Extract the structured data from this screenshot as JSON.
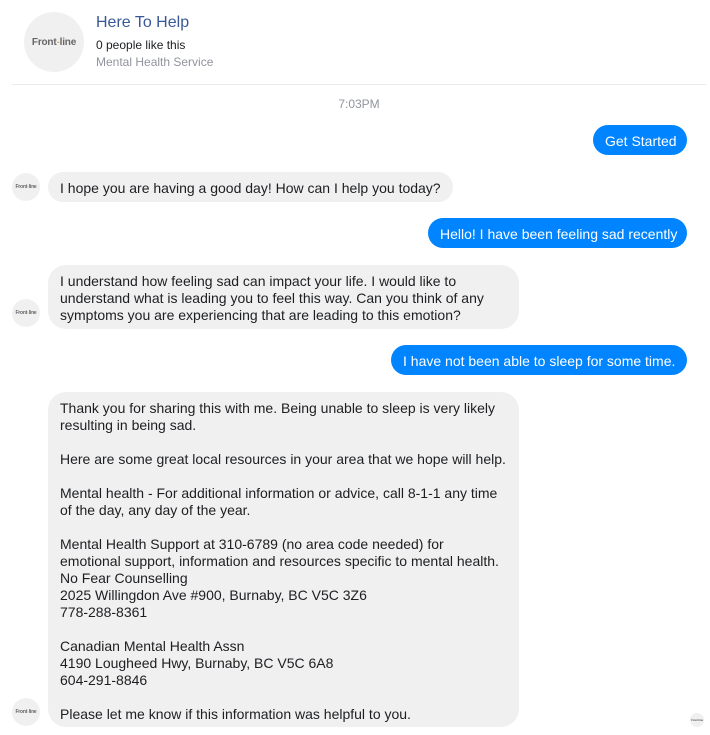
{
  "header": {
    "logo": {
      "left": "Front",
      "dash": "-",
      "right": "line"
    },
    "page_name": "Here To Help",
    "likes": "0 people like this",
    "category": "Mental Health Service"
  },
  "timestamp": "7:03PM",
  "messages": [
    {
      "sender": "user",
      "text": "Get Started"
    },
    {
      "sender": "bot",
      "text": "I hope you are having a good day! How can I help you today?"
    },
    {
      "sender": "user",
      "text": "Hello! I have been feeling sad recently"
    },
    {
      "sender": "bot",
      "text": "I understand how feeling sad can impact your life. I would like to\nunderstand what is leading you to feel this way. Can you think of any\nsymptoms you are experiencing that are leading to this emotion?"
    },
    {
      "sender": "user",
      "text": "I have not been able to sleep for some time."
    },
    {
      "sender": "bot",
      "text": "Thank you for sharing this with me. Being unable to sleep is very likely\nresulting in being sad.\n\nHere are some great local resources in your area that we hope will help.\n\nMental health - For additional information or advice, call 8-1-1 any time\nof the day, any day of the year.\n\nMental Health Support at 310-6789 (no area code needed) for\nemotional support, information and resources specific to mental health.\nNo Fear Counselling\n2025 Willingdon Ave #900, Burnaby, BC V5C 3Z6\n778-288-8361\n\nCanadian Mental Health Assn\n4190 Lougheed Hwy, Burnaby, BC V5C 6A8\n604-291-8846\n\nPlease let me know if this information was helpful to you."
    }
  ],
  "colors": {
    "user_bubble": "#0084ff",
    "bot_bubble": "#f1f0f0",
    "page_name": "#385898",
    "muted": "#90949c"
  }
}
